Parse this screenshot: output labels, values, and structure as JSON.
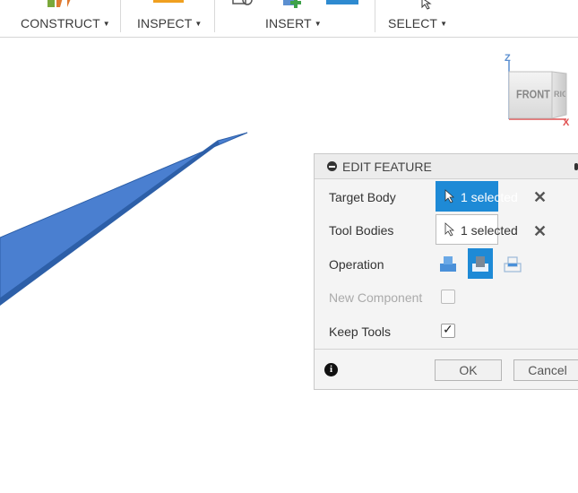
{
  "toolbar": {
    "groups": [
      {
        "label": "CONSTRUCT"
      },
      {
        "label": "INSPECT"
      },
      {
        "label": "INSERT"
      },
      {
        "label": "SELECT"
      }
    ]
  },
  "viewcube": {
    "face_label": "FRONT",
    "side_label": "RIGHT",
    "axis_z": "Z",
    "axis_x": "X"
  },
  "edit_feature": {
    "title": "EDIT FEATURE",
    "target_body": {
      "label": "Target Body",
      "value": "1 selected"
    },
    "tool_bodies": {
      "label": "Tool Bodies",
      "value": "1 selected"
    },
    "operation": {
      "label": "Operation",
      "options": [
        "join-icon",
        "cut-icon",
        "intersect-icon"
      ],
      "selected": "cut-icon"
    },
    "new_component": {
      "label": "New Component",
      "checked": false,
      "enabled": false
    },
    "keep_tools": {
      "label": "Keep Tools",
      "checked": true
    },
    "ok_label": "OK",
    "cancel_label": "Cancel"
  },
  "colors": {
    "accent": "#1e8ad6",
    "body_fill": "#4a7fd0"
  }
}
